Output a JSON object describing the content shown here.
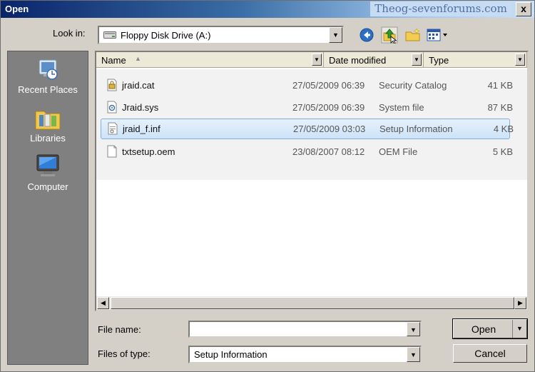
{
  "window": {
    "title": "Open",
    "watermark": "Theog-sevenforums.com",
    "close_glyph": "x"
  },
  "lookin": {
    "label": "Look in:",
    "value": "Floppy Disk Drive (A:)",
    "icon": "floppy-drive-icon"
  },
  "toolbar": {
    "buttons": [
      "back-icon",
      "up-folder-icon",
      "new-folder-icon",
      "view-menu-icon"
    ]
  },
  "places": {
    "items": [
      {
        "label": "Recent Places",
        "icon": "recent-places-icon"
      },
      {
        "label": "Libraries",
        "icon": "libraries-icon"
      },
      {
        "label": "Computer",
        "icon": "computer-icon"
      }
    ]
  },
  "filelist": {
    "columns": [
      "Name",
      "Date modified",
      "Type"
    ],
    "rows": [
      {
        "name": "jraid.cat",
        "date": "27/05/2009 06:39",
        "type": "Security Catalog",
        "size": "41 KB",
        "icon": "security-catalog-icon"
      },
      {
        "name": "Jraid.sys",
        "date": "27/05/2009 06:39",
        "type": "System file",
        "size": "87 KB",
        "icon": "system-file-icon"
      },
      {
        "name": "jraid_f.inf",
        "date": "27/05/2009 03:03",
        "type": "Setup Information",
        "size": "4 KB",
        "icon": "setup-info-icon",
        "selected": true
      },
      {
        "name": "txtsetup.oem",
        "date": "23/08/2007 08:12",
        "type": "OEM File",
        "size": "5 KB",
        "icon": "blank-file-icon"
      }
    ]
  },
  "form": {
    "filename_label": "File name:",
    "filename_value": "",
    "filetype_label": "Files of type:",
    "filetype_value": "Setup Information"
  },
  "buttons": {
    "open": "Open",
    "cancel": "Cancel"
  },
  "colors": {
    "selection_fill": "#cde3f8",
    "selection_border": "#84acdd",
    "places_bg": "#808080"
  }
}
